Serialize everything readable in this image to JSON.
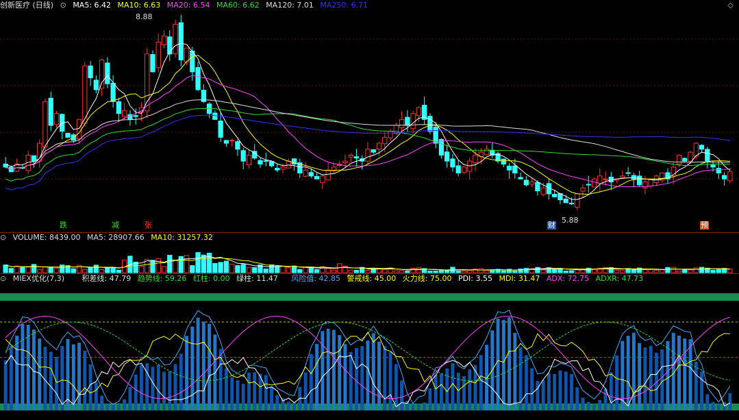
{
  "price_header": {
    "title": "创新医疗 (日线)",
    "items": [
      {
        "label": "MA5: 6.42",
        "color": "#ffffff"
      },
      {
        "label": "MA10: 6.63",
        "color": "#ffff00"
      },
      {
        "label": "MA20: 6.54",
        "color": "#ff44ff"
      },
      {
        "label": "MA60: 6.62",
        "color": "#33dd33"
      },
      {
        "label": "MA120: 7.01",
        "color": "#dddddd"
      },
      {
        "label": "MA250: 6.71",
        "color": "#3333ff"
      }
    ]
  },
  "price_annotations": {
    "high": "8.88",
    "low": "5.88"
  },
  "event_markers": [
    {
      "label": "跌",
      "color": "#33dd33",
      "bg": "transparent"
    },
    {
      "label": "减",
      "color": "#33dd33",
      "bg": "transparent"
    },
    {
      "label": "张",
      "color": "#ff3333",
      "bg": "transparent"
    },
    {
      "label": "财",
      "color": "#ffffff",
      "bg": "#2255aa"
    },
    {
      "label": "预",
      "color": "#ffffff",
      "bg": "#cc5522"
    }
  ],
  "volume_header": {
    "items": [
      {
        "label": "VOLUME: 8439.00",
        "color": "#dddddd"
      },
      {
        "label": "MA5: 28907.66",
        "color": "#dddddd"
      },
      {
        "label": "MA10: 31257.32",
        "color": "#ffff00"
      }
    ]
  },
  "indicator_header": {
    "items": [
      {
        "label": "MIEX优化(7,3)",
        "color": "#dddddd"
      },
      {
        "label": "积差线: 47.79",
        "color": "#dddddd"
      },
      {
        "label": "趋势线: 59.26",
        "color": "#33dd33"
      },
      {
        "label": "红柱: 0.00",
        "color": "#33dd33"
      },
      {
        "label": "绿柱: 11.47",
        "color": "#dddddd"
      },
      {
        "label": "风险值: 42.85",
        "color": "#44aaff"
      },
      {
        "label": "警戒线: 45.00",
        "color": "#ffff00"
      },
      {
        "label": "火力线: 75.00",
        "color": "#ffff00"
      },
      {
        "label": "PDI: 3.55",
        "color": "#ffffff"
      },
      {
        "label": "MDI: 31.47",
        "color": "#ffff00"
      },
      {
        "label": "ADX: 72.75",
        "color": "#ff44ff"
      },
      {
        "label": "ADXR: 47.73",
        "color": "#33dd33"
      }
    ]
  },
  "icons": {
    "collapse": "collapse-circle-icon",
    "corner": "diamond-icon"
  },
  "chart_data": {
    "type": "candlestick",
    "title": "创新医疗 (日线)",
    "colors": {
      "up": "#ff3333",
      "down": "#33ffff",
      "ma5": "#ffffff",
      "ma10": "#ffff00",
      "ma20": "#ff44ff",
      "ma60": "#33dd33",
      "ma120": "#dddddd",
      "ma250": "#3333ff"
    },
    "price_range": [
      5.6,
      9.1
    ],
    "close": [
      6.5,
      6.42,
      6.55,
      6.48,
      6.7,
      6.6,
      6.9,
      7.6,
      7.2,
      7.4,
      7.1,
      7.0,
      6.95,
      7.3,
      8.2,
      8.0,
      7.8,
      8.3,
      7.9,
      7.6,
      7.4,
      7.45,
      7.3,
      7.35,
      7.5,
      8.4,
      8.1,
      8.6,
      8.7,
      8.4,
      8.9,
      8.3,
      8.5,
      8.1,
      7.8,
      7.6,
      7.4,
      7.3,
      7.0,
      6.9,
      6.95,
      6.8,
      6.6,
      6.7,
      6.65,
      6.55,
      6.6,
      6.52,
      6.45,
      6.5,
      6.6,
      6.55,
      6.4,
      6.45,
      6.35,
      6.3,
      6.35,
      6.45,
      6.5,
      6.55,
      6.6,
      6.7,
      6.65,
      6.6,
      6.8,
      6.75,
      6.9,
      7.0,
      7.1,
      7.2,
      7.3,
      7.2,
      7.4,
      7.5,
      7.3,
      7.1,
      6.9,
      6.7,
      6.6,
      6.5,
      6.4,
      6.5,
      6.6,
      6.7,
      6.75,
      6.8,
      6.7,
      6.6,
      6.55,
      6.45,
      6.4,
      6.3,
      6.2,
      6.25,
      6.1,
      6.15,
      6.05,
      6.0,
      5.95,
      5.9,
      5.88,
      6.05,
      6.15,
      6.2,
      6.3,
      6.35,
      6.3,
      6.25,
      6.3,
      6.35,
      6.4,
      6.3,
      6.2,
      6.25,
      6.3,
      6.35,
      6.4,
      6.3,
      6.5,
      6.7,
      6.6,
      6.75,
      6.9,
      6.8,
      6.6,
      6.5,
      6.4,
      6.3,
      6.42
    ],
    "volume_max": 90000,
    "indicator_levels": {
      "warning": 45.0,
      "fire": 75.0
    },
    "indicator_range": [
      0,
      100
    ]
  }
}
